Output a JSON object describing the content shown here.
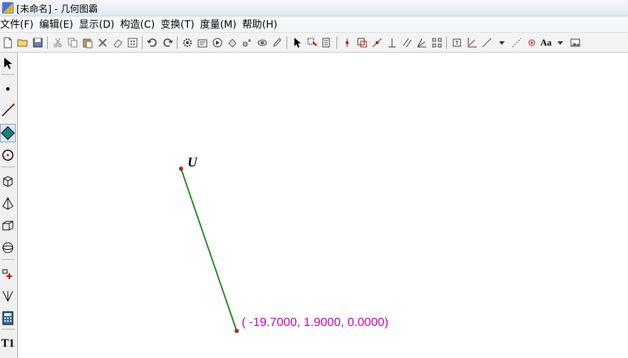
{
  "window": {
    "title": "[未命名] - 几何图霸"
  },
  "menu": {
    "items": [
      {
        "label": "文件(F)"
      },
      {
        "label": "编辑(E)"
      },
      {
        "label": "显示(D)"
      },
      {
        "label": "构造(C)"
      },
      {
        "label": "变换(T)"
      },
      {
        "label": "度量(M)"
      },
      {
        "label": "帮助(H)"
      }
    ]
  },
  "toolbar": {
    "text_style_label": "Aa"
  },
  "palette": {
    "text_tool_label": "T1"
  },
  "canvas": {
    "point_label": "U",
    "coordinate_readout": "( -19.7000, 1.9000, 0.0000)",
    "segment_color": "#1a8a1a",
    "point_color": "#a03020",
    "coordinate_color": "#c000c0"
  }
}
